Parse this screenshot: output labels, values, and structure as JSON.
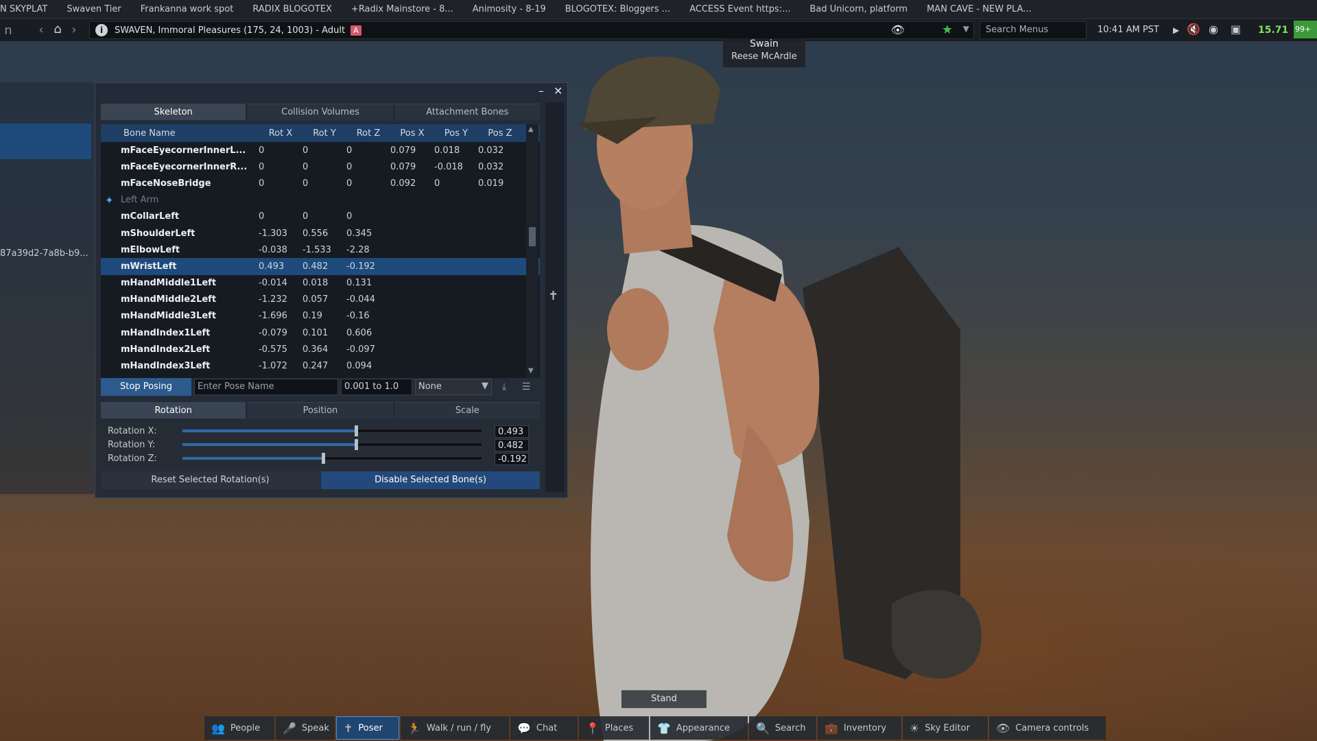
{
  "favorites": [
    "N SKYPLAT",
    "Swaven Tier",
    "Frankanna work spot",
    "RADIX BLOGOTEX",
    "+Radix  Mainstore - 8...",
    "Animosity - 8-19",
    "BLOGOTEX: Bloggers ...",
    "ACCESS Event  https:...",
    "Bad Unicorn, platform",
    "MAN CAVE - NEW PLA..."
  ],
  "navbar": {
    "location": "SWAVEN, Immoral Pleasures (175, 24, 1003) - Adult",
    "adult_badge": "A",
    "search_placeholder": "Search Menus",
    "clock": "10:41 AM PST",
    "fps": "15.71",
    "percent": "99+"
  },
  "nametag": {
    "line1": "Swain",
    "line2": "Reese McArdle"
  },
  "left_panel": {
    "uuid": "87a39d2-7a8b-b9..."
  },
  "poser": {
    "tabs": [
      "Skeleton",
      "Collision Volumes",
      "Attachment Bones"
    ],
    "columns": [
      "Bone Name",
      "Rot X",
      "Rot Y",
      "Rot Z",
      "Pos X",
      "Pos Y",
      "Pos Z"
    ],
    "rows": [
      {
        "name": "mFaceEyecornerInnerL...",
        "rx": "0",
        "ry": "0",
        "rz": "0",
        "px": "0.079",
        "py": "0.018",
        "pz": "0.032"
      },
      {
        "name": "mFaceEyecornerInnerR...",
        "rx": "0",
        "ry": "0",
        "rz": "0",
        "px": "0.079",
        "py": "-0.018",
        "pz": "0.032"
      },
      {
        "name": "mFaceNoseBridge",
        "rx": "0",
        "ry": "0",
        "rz": "0",
        "px": "0.092",
        "py": "0",
        "pz": "0.019"
      },
      {
        "name": "Left Arm",
        "group": true
      },
      {
        "name": "mCollarLeft",
        "rx": "0",
        "ry": "0",
        "rz": "0"
      },
      {
        "name": "mShoulderLeft",
        "rx": "-1.303",
        "ry": "0.556",
        "rz": "0.345"
      },
      {
        "name": "mElbowLeft",
        "rx": "-0.038",
        "ry": "-1.533",
        "rz": "-2.28"
      },
      {
        "name": "mWristLeft",
        "rx": "0.493",
        "ry": "0.482",
        "rz": "-0.192",
        "selected": true
      },
      {
        "name": "mHandMiddle1Left",
        "rx": "-0.014",
        "ry": "0.018",
        "rz": "0.131"
      },
      {
        "name": "mHandMiddle2Left",
        "rx": "-1.232",
        "ry": "0.057",
        "rz": "-0.044"
      },
      {
        "name": "mHandMiddle3Left",
        "rx": "-1.696",
        "ry": "0.19",
        "rz": "-0.16"
      },
      {
        "name": "mHandIndex1Left",
        "rx": "-0.079",
        "ry": "0.101",
        "rz": "0.606"
      },
      {
        "name": "mHandIndex2Left",
        "rx": "-0.575",
        "ry": "0.364",
        "rz": "-0.097"
      },
      {
        "name": "mHandIndex3Left",
        "rx": "-1.072",
        "ry": "0.247",
        "rz": "0.094"
      }
    ],
    "stop_posing": "Stop Posing",
    "pose_name_placeholder": "Enter Pose Name",
    "range_value": "0.001 to 1.0",
    "select_value": "None",
    "tabs2": [
      "Rotation",
      "Position",
      "Scale"
    ],
    "sliders": [
      {
        "label": "Rotation X:",
        "value": "0.493",
        "fraction": 0.58
      },
      {
        "label": "Rotation Y:",
        "value": "0.482",
        "fraction": 0.58
      },
      {
        "label": "Rotation Z:",
        "value": "-0.192",
        "fraction": 0.47
      }
    ],
    "reset_label": "Reset Selected Rotation(s)",
    "disable_label": "Disable Selected Bone(s)"
  },
  "stand_label": "Stand",
  "toolbar": [
    {
      "label": "People",
      "icon": "people-icon"
    },
    {
      "label": "Speak",
      "icon": "microphone-icon"
    },
    {
      "label": "Poser",
      "icon": "poser-icon",
      "active": true
    },
    {
      "label": "Walk / run / fly",
      "icon": "walk-icon"
    },
    {
      "label": "Chat",
      "icon": "chat-icon"
    },
    {
      "label": "Places",
      "icon": "places-icon"
    },
    {
      "label": "Appearance",
      "icon": "appearance-icon"
    },
    {
      "label": "Search",
      "icon": "search-icon"
    },
    {
      "label": "Inventory",
      "icon": "inventory-icon"
    },
    {
      "label": "Sky Editor",
      "icon": "sky-editor-icon"
    },
    {
      "label": "Camera controls",
      "icon": "camera-icon"
    }
  ]
}
